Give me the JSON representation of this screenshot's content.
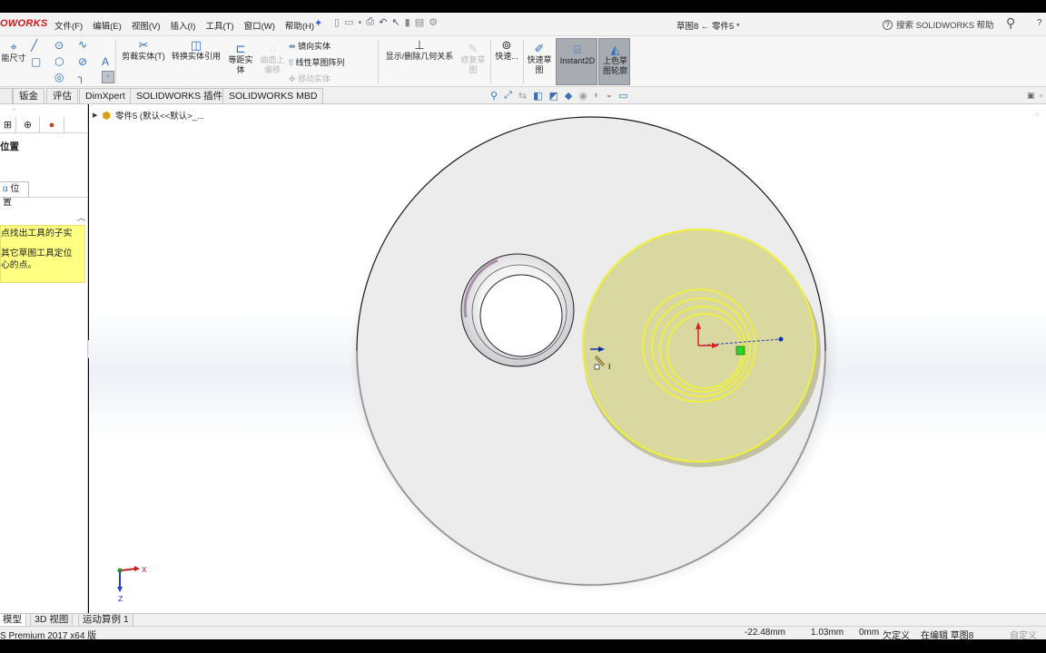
{
  "app": {
    "logo": "OWORKS",
    "menu": [
      "文件(F)",
      "编辑(E)",
      "视图(V)",
      "插入(I)",
      "工具(T)",
      "窗口(W)",
      "帮助(H)"
    ],
    "document_title": "草图8 ← 零件5 *",
    "help_search": "搜索 SOLIDWORKS 帮助",
    "help_question": "?"
  },
  "ribbon": {
    "smart_dimension": "能尺寸",
    "trim_entities": "剪裁实体(T)",
    "convert_entities": "转换实体引用",
    "offset_entities": [
      "等距实",
      "体"
    ],
    "offset_on_surface": [
      "曲面上",
      "偏移"
    ],
    "mirror_entities": "镜向实体",
    "linear_pattern": "线性草图阵列",
    "move_entities": "移动实体",
    "display_delete_relations": "显示/删除几何关系",
    "repair_sketch": [
      "修复草",
      "图"
    ],
    "quick_snaps": "快速...",
    "rapid_sketch": [
      "快速草",
      "图"
    ],
    "instant2d": "Instant2D",
    "shaded_contours": [
      "上色草",
      "图轮廓"
    ]
  },
  "tabs": [
    "钣金",
    "评估",
    "DimXpert",
    "SOLIDWORKS 插件",
    "SOLIDWORKS MBD"
  ],
  "left_panel": {
    "title": "位置",
    "tab_label": "位置",
    "hint_lines": [
      "点找出工具的子实",
      "其它草图工具定位",
      "心的点。"
    ]
  },
  "tree": {
    "root_label": "零件5  (默认<<默认>_..."
  },
  "bottom_tabs": [
    "模型",
    "3D 视图",
    "运动算例 1"
  ],
  "status": {
    "product": "S Premium 2017 x64 版",
    "x": "-22.48mm",
    "y": "1.03mm",
    "z": "0mm",
    "defined_state": "欠定义",
    "editing": "在编辑 草图8",
    "custom": "自定义"
  },
  "axes": {
    "x": "X",
    "z": "Z"
  },
  "colors": {
    "sketch_yellow": "#f0f03a",
    "face_highlight": "#d8d8a0",
    "origin_red": "#e02020",
    "axis_blue": "#2040c0",
    "hint_background": "#ffff82"
  }
}
